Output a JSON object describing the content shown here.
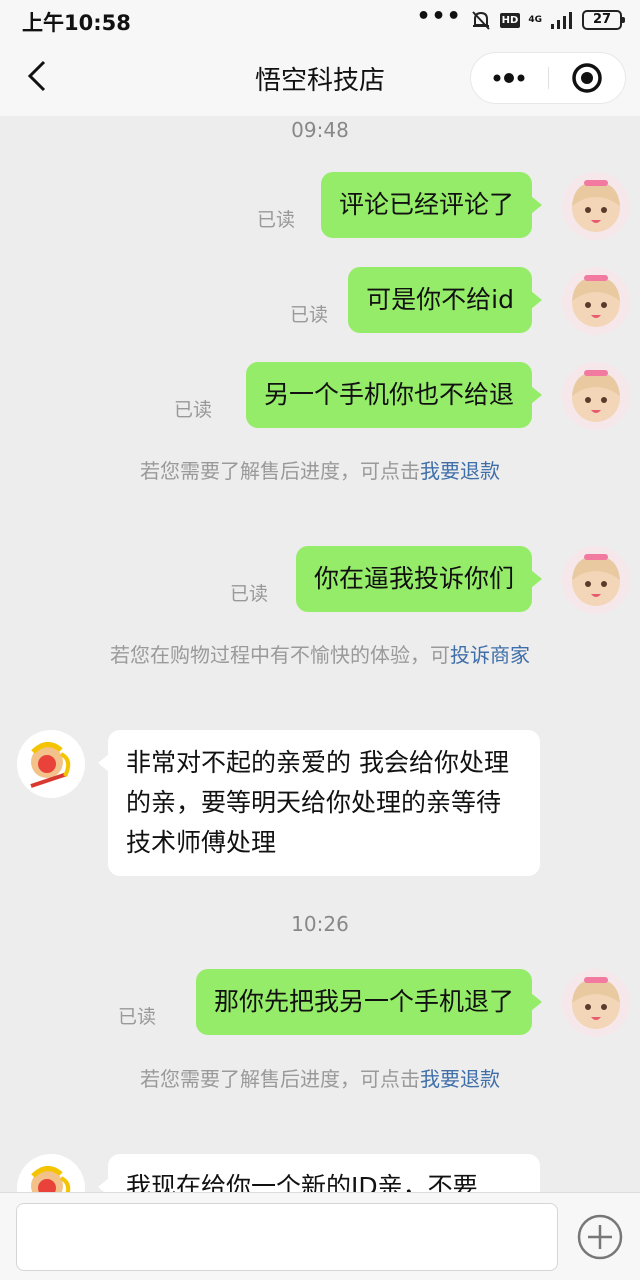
{
  "status_bar": {
    "time": "上午10:58",
    "more": "•••",
    "hd": "HD",
    "network": "4G",
    "battery": "27"
  },
  "header": {
    "title": "悟空科技店",
    "back_icon": "chevron-left-icon",
    "menu_icon": "more-dots-icon",
    "close_icon": "target-circle-icon"
  },
  "chat": {
    "timestamps": [
      "09:48",
      "10:26"
    ],
    "read_label": "已读",
    "messages": [
      {
        "from": "me",
        "text": "评论已经评论了"
      },
      {
        "from": "me",
        "text": "可是你不给id"
      },
      {
        "from": "me",
        "text": "另一个手机你也不给退"
      },
      {
        "from": "me",
        "text": "你在逼我投诉你们"
      },
      {
        "from": "shop",
        "text": "非常对不起的亲爱的 我会给你处理的亲，要等明天给你处理的亲等待技术师傅处理"
      },
      {
        "from": "me",
        "text": "那你先把我另一个手机退了"
      },
      {
        "from": "shop",
        "text": "我现在给你一个新的ID亲，不要"
      }
    ],
    "notices": {
      "refund_prefix": "若您需要了解售后进度，可点击",
      "refund_link": "我要退款",
      "complain_prefix": "若您在购物过程中有不愉快的体验，可",
      "complain_link": "投诉商家"
    }
  },
  "input_bar": {
    "plus_icon": "plus-circle-icon"
  },
  "colors": {
    "my_bubble": "#95ec69",
    "shop_bubble": "#ffffff",
    "link": "#3f6fa9",
    "background": "#ededed"
  }
}
